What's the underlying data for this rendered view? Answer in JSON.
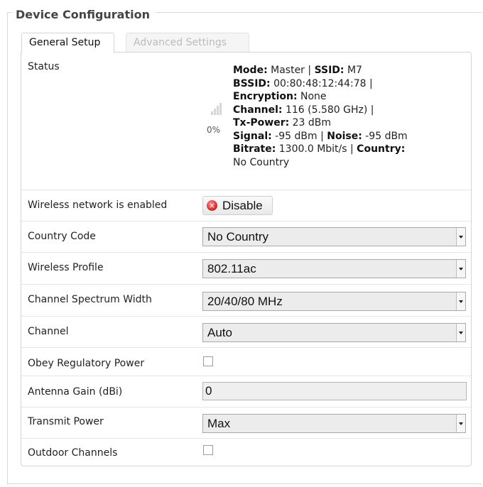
{
  "fieldset": {
    "legend": "Device Configuration"
  },
  "tabs": [
    {
      "label": "General Setup",
      "active": true
    },
    {
      "label": "Advanced Settings",
      "active": false
    }
  ],
  "status": {
    "label": "Status",
    "signal_percent": "0%",
    "mode_key": "Mode:",
    "mode_val": " Master | ",
    "ssid_key": "SSID:",
    "ssid_val": " M7",
    "bssid_key": "BSSID:",
    "bssid_val": " 00:80:48:12:44:78 |",
    "enc_key": "Encryption:",
    "enc_val": " None",
    "channel_key": "Channel:",
    "channel_val": " 116 (5.580 GHz) |",
    "txpower_key": "Tx-Power:",
    "txpower_val": " 23 dBm",
    "signal_key": "Signal:",
    "signal_val": " -95 dBm | ",
    "noise_key": "Noise:",
    "noise_val": " -95 dBm",
    "bitrate_key": "Bitrate:",
    "bitrate_val": " 1300.0 Mbit/s | ",
    "country_key": "Country:",
    "country_val": "No Country"
  },
  "wireless_enabled": {
    "label": "Wireless network is enabled",
    "button": "Disable"
  },
  "country_code": {
    "label": "Country Code",
    "value": "No Country"
  },
  "wireless_profile": {
    "label": "Wireless Profile",
    "value": "802.11ac"
  },
  "spectrum_width": {
    "label": "Channel Spectrum Width",
    "value": "20/40/80 MHz"
  },
  "channel": {
    "label": "Channel",
    "value": "Auto"
  },
  "obey_power": {
    "label": "Obey Regulatory Power",
    "checked": false
  },
  "antenna_gain": {
    "label": "Antenna Gain (dBi)",
    "value": "0"
  },
  "transmit_power": {
    "label": "Transmit Power",
    "value": "Max"
  },
  "outdoor_channels": {
    "label": "Outdoor Channels",
    "checked": false
  }
}
